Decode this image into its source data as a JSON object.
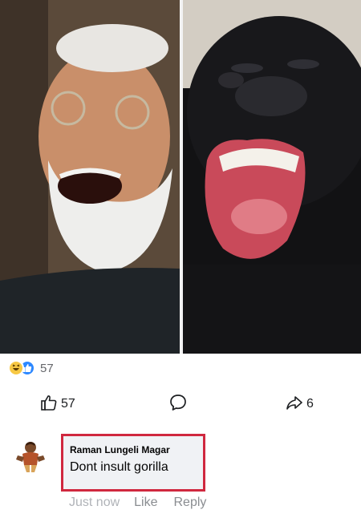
{
  "post": {
    "reactions": {
      "icons": [
        "haha-emoji-icon",
        "like-badge-icon"
      ],
      "count": "57"
    },
    "actions": {
      "like_icon": "thumbs-up-icon",
      "like_count": "57",
      "comment_icon": "comment-bubble-icon",
      "share_icon": "share-arrow-icon",
      "share_count": "6"
    }
  },
  "comment": {
    "avatar_icon": "avatar-icon",
    "author": "Raman Lungeli Magar",
    "text": "Dont insult gorilla",
    "highlight_color": "#d0283f",
    "meta": {
      "time": "Just now",
      "like": "Like",
      "reply": "Reply"
    }
  }
}
